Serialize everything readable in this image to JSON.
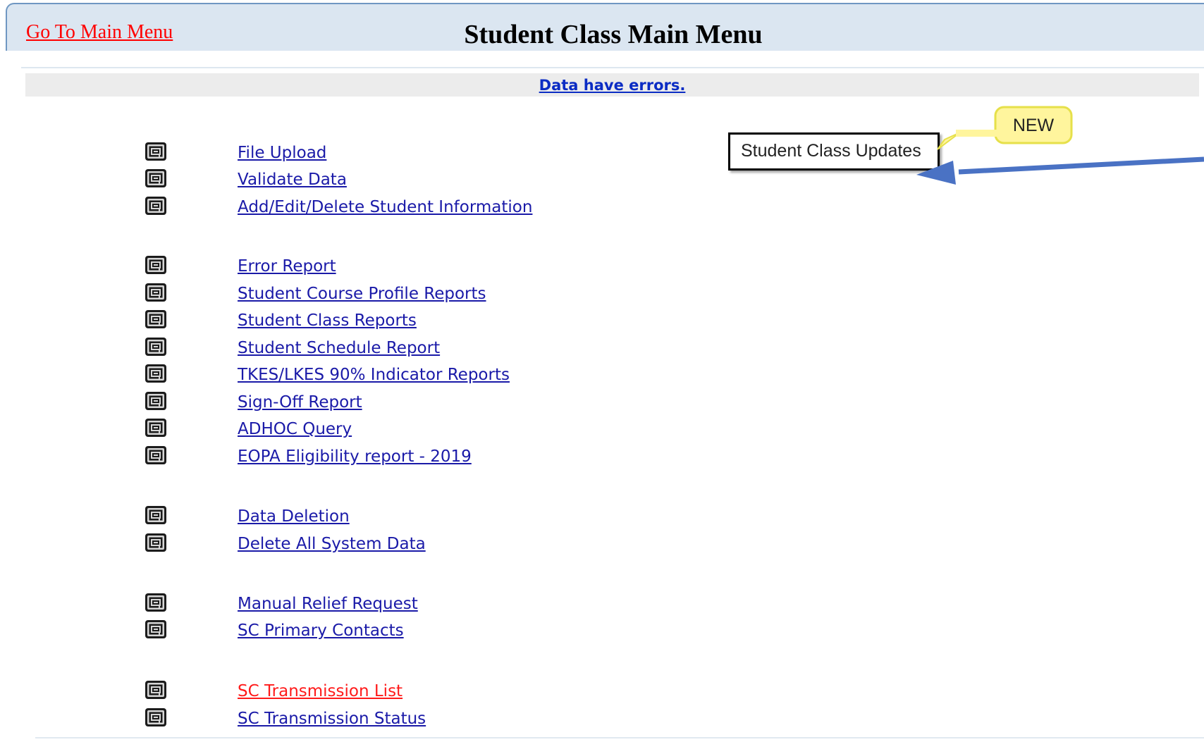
{
  "header": {
    "home_link": "Go To Main Menu",
    "title": "Student Class Main Menu"
  },
  "banner": {
    "error_text": "Data have errors."
  },
  "menu": {
    "items": [
      {
        "label": "File Upload"
      },
      {
        "label": "Validate Data"
      },
      {
        "label": "Add/Edit/Delete Student Information"
      },
      {
        "label": "Error Report"
      },
      {
        "label": "Student Course Profile Reports"
      },
      {
        "label": "Student Class Reports"
      },
      {
        "label": "Student Schedule Report"
      },
      {
        "label": "TKES/LKES 90% Indicator Reports"
      },
      {
        "label": "Sign-Off Report"
      },
      {
        "label": "ADHOC Query"
      },
      {
        "label": "EOPA Eligibility report - 2019"
      },
      {
        "label": "Data Deletion"
      },
      {
        "label": "Delete All System Data"
      },
      {
        "label": "Manual Relief Request"
      },
      {
        "label": "SC Primary Contacts"
      },
      {
        "label": "SC Transmission List",
        "color": "#ff1a1a"
      },
      {
        "label": "SC Transmission Status"
      }
    ],
    "icon": "square-spiral-icon"
  },
  "annotation": {
    "updates_label": "Student Class Updates",
    "new_badge": "NEW",
    "badge_color": "#fff59d",
    "badge_border_color": "#e6e04a",
    "arrow_color": "#4a72c4"
  },
  "colors": {
    "link": "#1a1aa8",
    "home_link": "#ff0000",
    "header_band": "#dbe6f1",
    "error_link": "#0b2cc4"
  }
}
